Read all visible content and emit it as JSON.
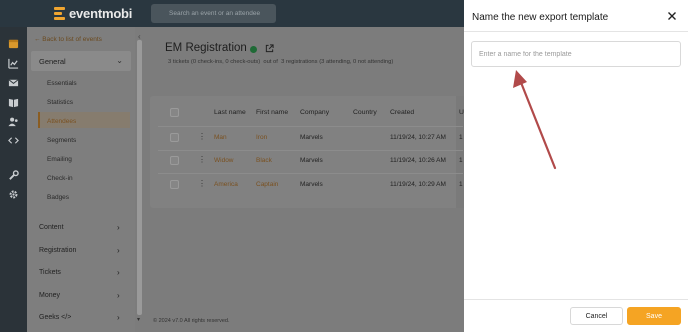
{
  "app": {
    "brand": "eventmobi",
    "search_placeholder": "Search an event or an attendee"
  },
  "rail_icons": [
    "calendar-icon",
    "chart-icon",
    "mail-icon",
    "book-icon",
    "people-icon",
    "code-icon",
    "wrench-icon",
    "gear-icon"
  ],
  "sidebar": {
    "back_link": "← Back to list of events",
    "group": {
      "label": "General",
      "chevron": "⌄"
    },
    "sub_items": [
      {
        "label": "Essentials",
        "active": false
      },
      {
        "label": "Statistics",
        "active": false
      },
      {
        "label": "Attendees",
        "active": true
      },
      {
        "label": "Segments",
        "active": false
      },
      {
        "label": "Emailing",
        "active": false
      },
      {
        "label": "Check-in",
        "active": false
      },
      {
        "label": "Badges",
        "active": false
      }
    ],
    "sections": [
      {
        "label": "Content",
        "chevron": "›"
      },
      {
        "label": "Registration",
        "chevron": "›"
      },
      {
        "label": "Tickets",
        "chevron": "›"
      },
      {
        "label": "Money",
        "chevron": "›"
      },
      {
        "label": "Geeks </>",
        "chevron": "›"
      }
    ]
  },
  "main": {
    "title": "EM Registration",
    "stats": {
      "tickets": "3 tickets",
      "tickets_detail": "(0 check-ins, 0 check-outs)",
      "out_of": "out of",
      "registrations": "3 registrations",
      "registrations_detail": "(3 attending, 0 not attending)"
    },
    "table": {
      "headers": [
        "Last name",
        "First name",
        "Company",
        "Country",
        "Created",
        "U"
      ],
      "rows": [
        {
          "last": "Man",
          "first": "Iron",
          "company": "Marvels",
          "country": "",
          "created": "11/19/24, 10:27 AM",
          "extra": "1"
        },
        {
          "last": "Widow",
          "first": "Black",
          "company": "Marvels",
          "country": "",
          "created": "11/19/24, 10:26 AM",
          "extra": "1"
        },
        {
          "last": "America",
          "first": "Captain",
          "company": "Marvels",
          "country": "",
          "created": "11/19/24, 10:29 AM",
          "extra": "1"
        }
      ]
    },
    "footer": "© 2024 v7.0 All rights reserved."
  },
  "drawer": {
    "title": "Name the new export template",
    "input_placeholder": "Enter a name for the template",
    "input_value": "",
    "cancel_label": "Cancel",
    "save_label": "Save"
  },
  "colors": {
    "topbar": "#2a3740",
    "accent": "#f5a423",
    "link": "#7a5120",
    "annotation_arrow": "#b14a4a",
    "status_dot": "#1f6a36"
  }
}
